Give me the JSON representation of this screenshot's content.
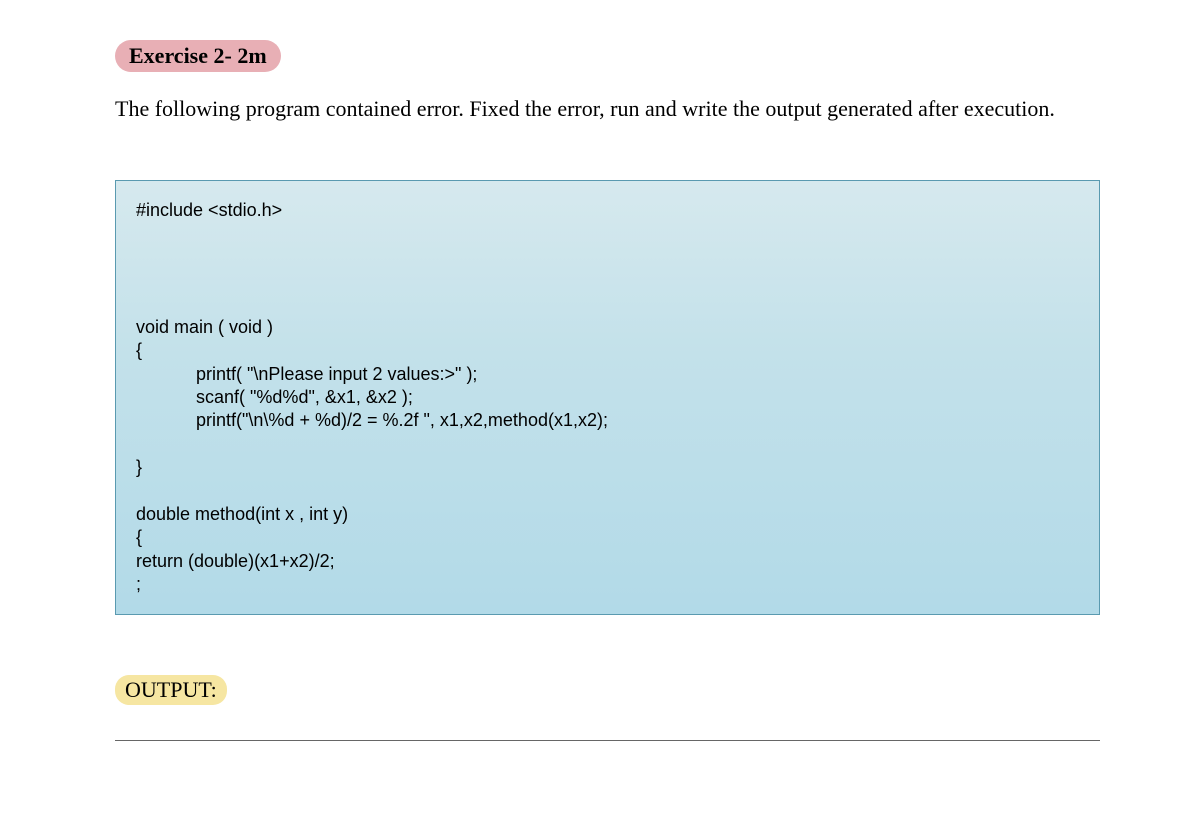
{
  "exercise_label": "Exercise 2- 2m",
  "instruction": "The following program contained error. Fixed the error, run and write the output generated after execution.",
  "code": "#include <stdio.h>\n\n\n\n\nvoid main ( void )\n{\n            printf( \"\\nPlease input 2 values:>\" );\n            scanf( \"%d%d\", &x1, &x2 );\n            printf(\"\\n\\%d + %d)/2 = %.2f \", x1,x2,method(x1,x2);\n\n}\n\ndouble method(int x , int y)\n{\nreturn (double)(x1+x2)/2;\n;",
  "output_label": "OUTPUT:"
}
